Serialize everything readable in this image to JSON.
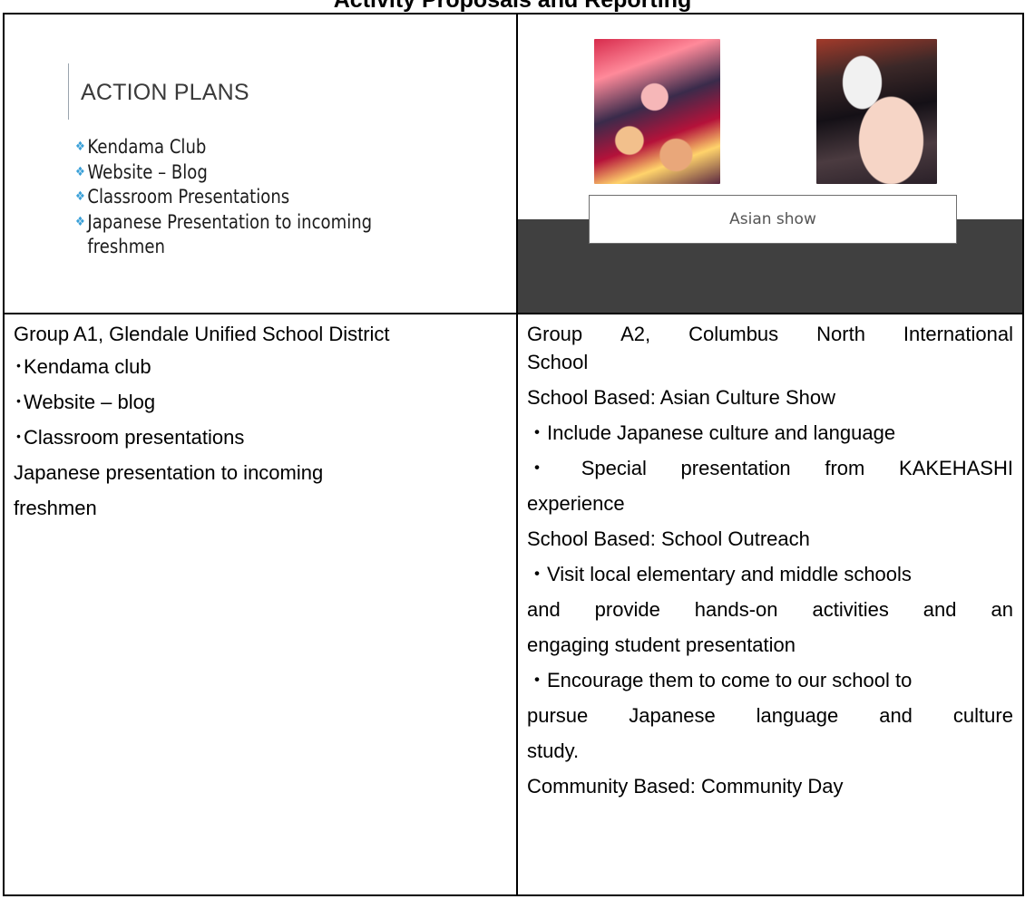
{
  "heading": "Activity Proposals and Reporting",
  "slide1": {
    "title": "ACTION PLANS",
    "items": [
      "Kendama Club",
      "Website – Blog",
      "Classroom Presentations",
      "Japanese Presentation to incoming freshmen"
    ]
  },
  "slide2": {
    "caption": "Asian show"
  },
  "left": {
    "group": "Group A1, Glendale Unified School District",
    "lines": [
      "･Kendama club",
      "･Website – blog",
      "･Classroom presentations",
      "Japanese presentation to incoming",
      "freshmen"
    ]
  },
  "right": {
    "group_line1": [
      "Group",
      "A2,",
      "Columbus",
      "North",
      "International"
    ],
    "group_line2": "School",
    "lines": [
      "School Based: Asian Culture Show",
      "・Include Japanese culture and language",
      "・ Special presentation from KAKEHASHI",
      "experience",
      "School Based: School Outreach",
      "・Visit local elementary and middle schools",
      "and provide hands-on activities and an",
      "engaging student presentation",
      "・Encourage them to come to our school to",
      "pursue Japanese language and culture",
      "study.",
      "Community Based: Community Day"
    ],
    "justified_a": [
      "・",
      "Special",
      "presentation",
      "from",
      "KAKEHASHI"
    ],
    "justified_b": [
      "and",
      "provide",
      "hands-on",
      "activities",
      "and",
      "an"
    ],
    "justified_c": [
      "pursue",
      "Japanese",
      "language",
      "and",
      "culture"
    ]
  }
}
